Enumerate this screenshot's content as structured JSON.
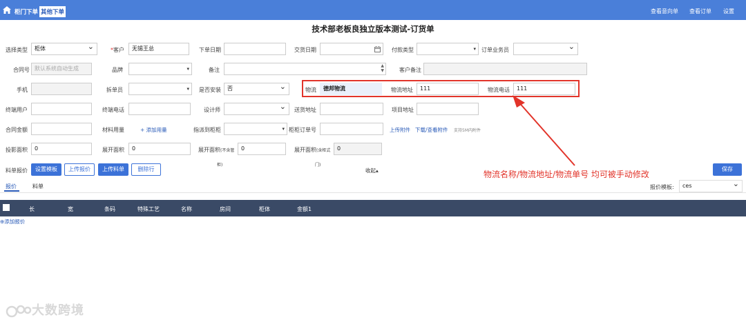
{
  "topbar": {
    "tabs": [
      "柜门下单",
      "其他下单"
    ],
    "right": [
      "查看意向单",
      "查看订单",
      "设置"
    ]
  },
  "title": "技术部老板良独立版本测试-订货单",
  "row1": {
    "type_label": "选择类型",
    "type_value": "柜体",
    "customer_label": "客户",
    "customer_value": "无锡王总",
    "order_date_label": "下单日期",
    "delivery_date_label": "交货日期",
    "payment_label": "付款类型",
    "salesman_label": "订单业务员"
  },
  "row2": {
    "contract_label": "合同号",
    "contract_placeholder": "默认系统自动生成",
    "brand_label": "品牌",
    "remark_label": "备注",
    "customer_remark_label": "客户备注"
  },
  "row3": {
    "phone_label": "手机",
    "splitter_label": "拆单员",
    "install_label": "是否安装",
    "install_value": "否",
    "logistics_label": "物流",
    "logistics_value": "德邦物流",
    "log_addr_label": "物流地址",
    "log_addr_value": "111",
    "log_phone_label": "物流电话",
    "log_phone_value": "111"
  },
  "row4": {
    "end_user_label": "终端用户",
    "end_phone_label": "终端电话",
    "designer_label": "设计师",
    "ship_addr_label": "送货地址",
    "project_addr_label": "项目地址"
  },
  "row5": {
    "amount_label": "合同金额",
    "material_label": "材料用量",
    "add_usage": "+ 添加用量",
    "assign_label": "指派到柜柜",
    "cab_order_label": "柜柜订单号",
    "upload_attach": "上传附件",
    "download_attach": "下载/查看附件",
    "size_hint": "支持5M内附件"
  },
  "row6": {
    "proj_area_label": "投影面积",
    "proj_area_value": "0",
    "unfold_label": "展开面积",
    "unfold_value": "0",
    "unfold_nodoor_label": "展开面积",
    "unfold_nodoor_note": "(不含管",
    "unfold_nodoor_note2": "柜)",
    "unfold_nodoor_value": "0",
    "unfold_door_label": "展开面积",
    "unfold_door_note": "(含柜式",
    "unfold_door_note2": "门)",
    "unfold_door_value": "0"
  },
  "toolbar": {
    "label": "料单报价",
    "set_template": "设置模板",
    "upload_quote": "上传报价",
    "upload_bom": "上传料单",
    "delete_row": "删除行",
    "collapse": "收起▴",
    "save": "保存"
  },
  "annotation": "物流名称/物流地址/物流单号  均可被手动修改",
  "tabs": [
    "报价",
    "料单"
  ],
  "template_label": "报价模板:",
  "template_value": "ces",
  "table_headers": [
    "长",
    "宽",
    "条码",
    "特殊工艺",
    "名称",
    "房间",
    "柜体",
    "金额1"
  ],
  "add_quote": "⊕添加报价",
  "watermark": "大数跨境"
}
